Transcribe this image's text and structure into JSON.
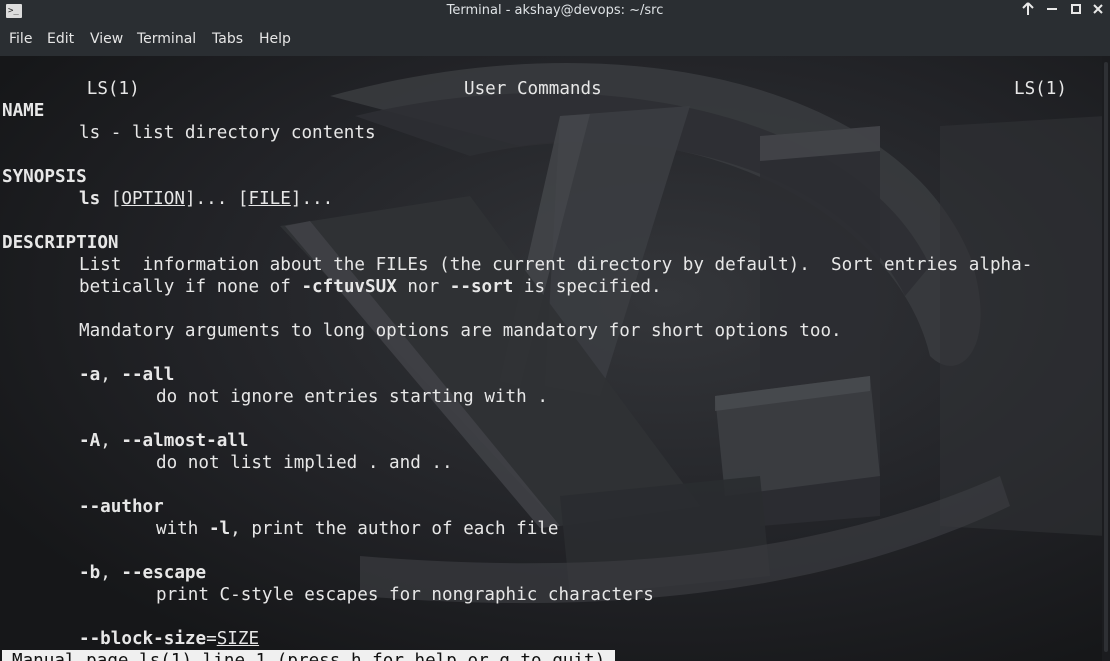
{
  "window": {
    "title": "Terminal - akshay@devops: ~/src",
    "app_icon_text": ">_",
    "buttons": {
      "keep_above": "↑",
      "minimize": "—",
      "maximize": "□",
      "close": "✕"
    }
  },
  "menu": {
    "items": [
      "File",
      "Edit",
      "View",
      "Terminal",
      "Tabs",
      "Help"
    ]
  },
  "man": {
    "header_left": "LS(1)",
    "header_center": "User Commands",
    "header_right": "LS(1)",
    "name_heading": "NAME",
    "name_text": "ls - list directory contents",
    "synopsis_heading": "SYNOPSIS",
    "synopsis": {
      "cmd": "ls",
      "sp1": " [",
      "option": "OPTION",
      "mid": "]... [",
      "file": "FILE",
      "end": "]..."
    },
    "description_heading": "DESCRIPTION",
    "desc_line1": "List  information about the FILEs (the current directory by default).  Sort entries alpha-",
    "desc_line2": {
      "a": "betically if none of ",
      "b": "-cftuvSUX",
      "c": " nor ",
      "d": "--sort",
      "e": " is specified."
    },
    "mandatory": "Mandatory arguments to long options are mandatory for short options too.",
    "options": [
      {
        "flag_short": "-a",
        "sep": ", ",
        "flag_long": "--all",
        "desc": "do not ignore entries starting with ."
      },
      {
        "flag_short": "-A",
        "sep": ", ",
        "flag_long": "--almost-all",
        "desc": "do not list implied . and .."
      },
      {
        "flag_long": "--author",
        "desc_pre": "with ",
        "desc_flag": "-l",
        "desc_post": ", print the author of each file"
      },
      {
        "flag_short": "-b",
        "sep": ", ",
        "flag_long": "--escape",
        "desc": "print C-style escapes for nongraphic characters"
      },
      {
        "flag_long": "--block-size",
        "eq": "=",
        "arg": "SIZE"
      }
    ]
  },
  "status": "Manual page ls(1) line 1 (press h for help or q to quit)",
  "colors": {
    "titlebar": "#2a2e32",
    "terminal_bg": "#1b1c1f",
    "text": "#e7e7e7",
    "status_bg": "#f0f0f0"
  }
}
